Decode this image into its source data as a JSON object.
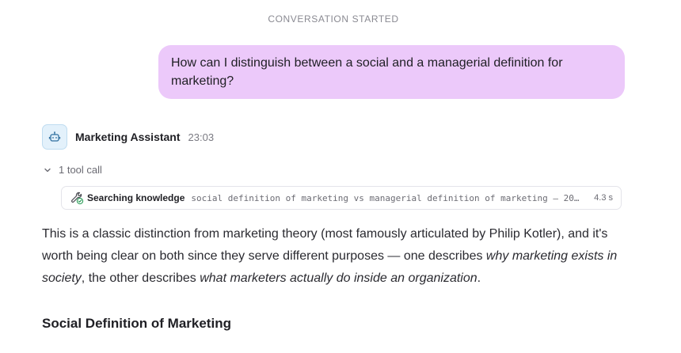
{
  "conversation": {
    "started_label": "CONVERSATION STARTED"
  },
  "user_message": {
    "text": "How can I distinguish between a social and a managerial definition for marketing?"
  },
  "assistant": {
    "name": "Marketing Assistant",
    "time": "23:03",
    "avatar_icon": "robot-icon",
    "tool_calls": {
      "toggle_label": "1 tool call",
      "items": [
        {
          "icon": "wrench-check-icon",
          "label": "Searching knowledge",
          "query": "social definition of marketing vs managerial definition of marketing — 20…",
          "duration": "4.3 s"
        }
      ]
    },
    "message": {
      "part1": "This is a classic distinction from marketing theory (most famously articulated by Philip Kotler), and it's worth being clear on both since they serve different purposes — one describes ",
      "em1": "why marketing exists in society",
      "part2": ", the other describes ",
      "em2": "what marketers actually do inside an organization",
      "part3": ".",
      "heading": "Social Definition of Marketing"
    }
  },
  "colors": {
    "user_bubble": "#ecc9fa",
    "avatar_bg": "#e3f1fb",
    "accent_icon": "#2f6f9f",
    "success_check": "#2e9e5b"
  }
}
